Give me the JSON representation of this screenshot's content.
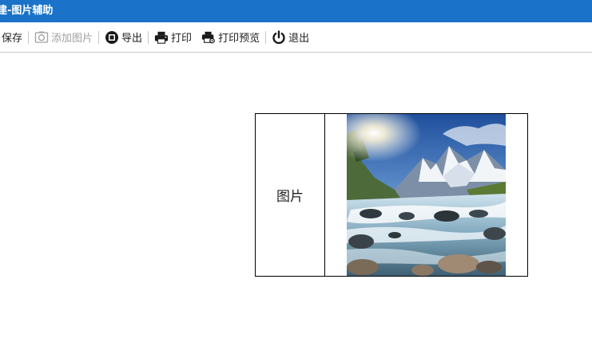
{
  "window": {
    "title": "建-图片辅助"
  },
  "toolbar": {
    "save_label": "保存",
    "add_picture_label": "添加图片",
    "export_label": "导出",
    "print_label": "打印",
    "print_preview_label": "打印预览",
    "exit_label": "退出"
  },
  "field": {
    "label": "图片"
  },
  "colors": {
    "titlebar": "#1a73c8",
    "disabled_text": "#a0a0a0"
  }
}
